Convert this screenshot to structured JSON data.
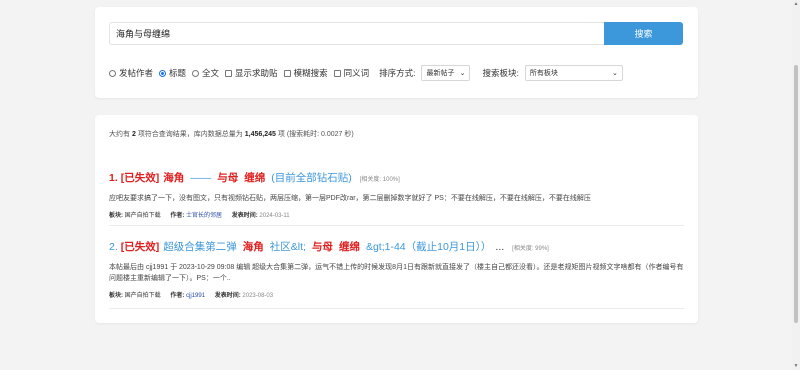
{
  "search": {
    "query": "海角与母缠绵",
    "button_label": "搜索"
  },
  "options": {
    "radio_author": "发帖作者",
    "radio_title": "标题",
    "radio_fulltext": "全文",
    "selected_radio": "标题",
    "check_help": "显示求助贴",
    "check_fuzzy": "模糊搜索",
    "check_synonym": "同义词",
    "sort_label": "排序方式:",
    "sort_value": "最新帖子",
    "board_label": "搜索板块:",
    "board_value": "所有板块"
  },
  "summary": {
    "prefix": "大约有",
    "count": "2",
    "middle": "项符合查询结果，库内数据总量为",
    "total": "1,456,245",
    "suffix": "项 (搜索耗时: 0.0027 秒)"
  },
  "results": [
    {
      "num": "1.",
      "tag": "[已失效]",
      "title_parts": [
        "海角",
        "——",
        "与母",
        "缠绵",
        "(目前全部钻石贴)"
      ],
      "relevance": "[相关度: 100%]",
      "snippet": "应吧友要求搞了一下，没有图文，只有视频钻石贴，两层压缩，第一层PDF改rar，第二层删掉数字就好了 PS：不要在线解压，不要在线解压，不要在线解压",
      "board_key": "板块:",
      "board": "国产自拍下载",
      "author_key": "作者:",
      "author": "士官长的邻居",
      "date_key": "发表时间:",
      "date": "2024-03-11"
    },
    {
      "num": "2.",
      "tag": "[已失效]",
      "title_parts": [
        "超级合集第二弹",
        "海角",
        "社区&lt;",
        "与母",
        "缠绵",
        "&gt;1-44（截止10月1日））",
        "..."
      ],
      "relevance": "[相关度: 99%]",
      "snippet": "本帖最后由 cjj1991 于 2023-10-29 09:08 编辑 超级大合集第二弹，运气不错上传的时候发现8月1日有跟新就直接发了（楼主自己都还没看）。还是老规矩图片视频文字啥都有（作者编号有问题楼主重新编辑了一下）。PS：一个..",
      "board_key": "板块:",
      "board": "国产自拍下载",
      "author_key": "作者:",
      "author": "cjj1991",
      "date_key": "发表时间:",
      "date": "2023-08-03"
    }
  ],
  "colors": {
    "accent": "#3d97db",
    "highlight": "#e02020",
    "background": "#f3f3f3"
  }
}
